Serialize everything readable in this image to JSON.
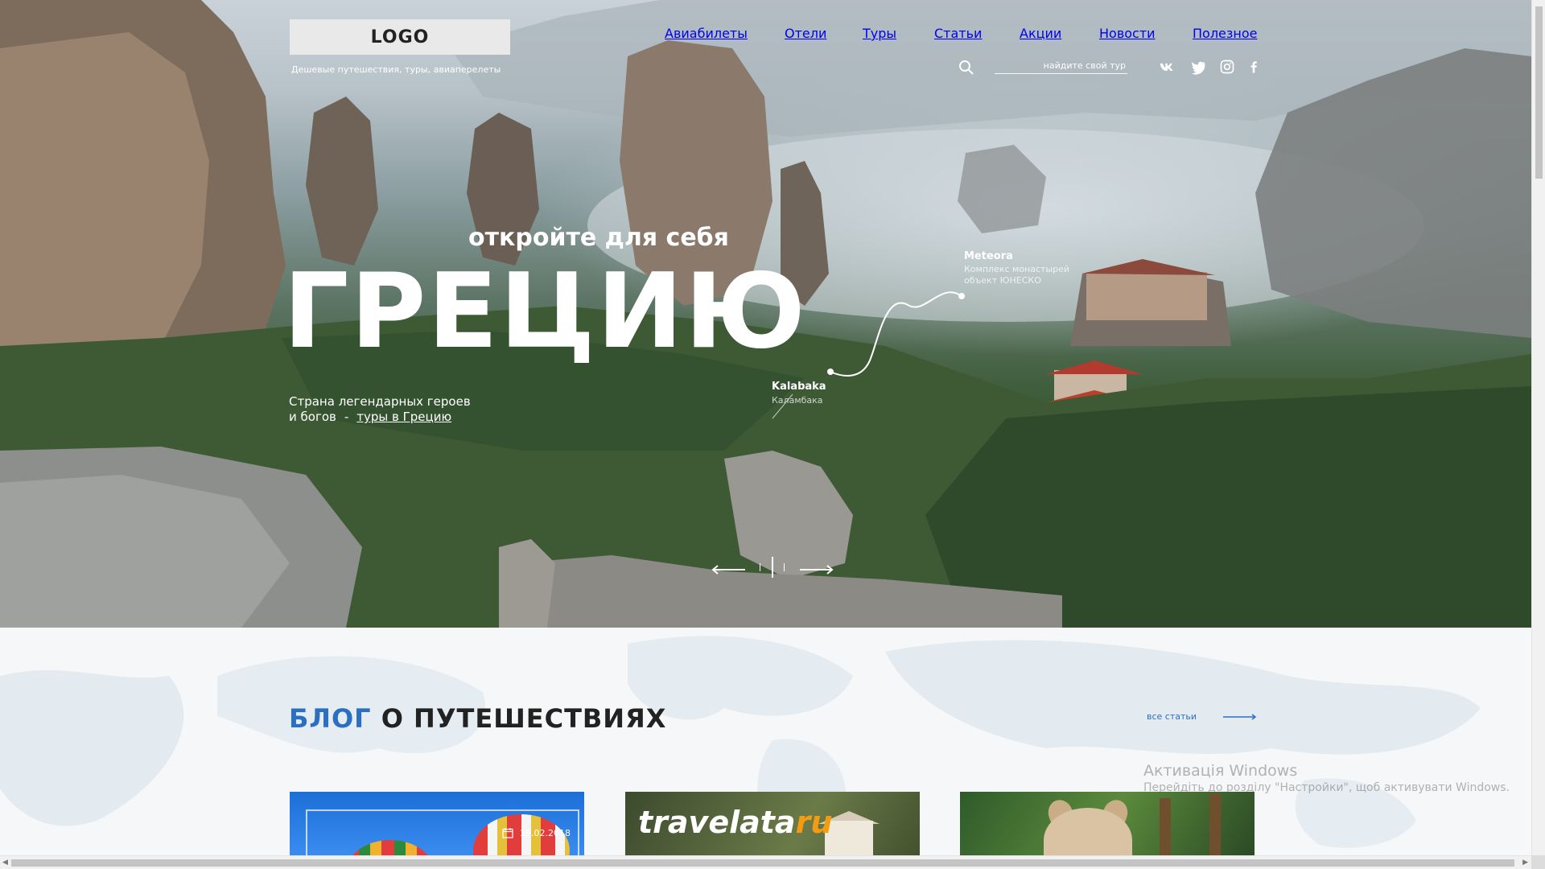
{
  "header": {
    "logo": "LOGO",
    "tagline": "Дешевые путешествия, туры, авиаперелеты",
    "nav": [
      "Авиабилеты",
      "Отели",
      "Туры",
      "Статьи",
      "Акции",
      "Новости",
      "Полезное"
    ],
    "search_placeholder": "найдите свой тур",
    "social": [
      "vk-icon",
      "twitter-icon",
      "instagram-icon",
      "facebook-icon"
    ]
  },
  "hero": {
    "subheadline": "откройте для себя",
    "headline": "ГРЕЦИЮ",
    "description_line1": "Страна легендарных героев",
    "description_line2": "и богов",
    "description_sep": "-",
    "link": "туры в Грецию",
    "pins": [
      {
        "title": "Meteora",
        "sub1": "Комплекс монастырей",
        "sub2": "объект ЮНЕСКО"
      },
      {
        "title": "Kalabaka",
        "sub1": "Каламбака"
      }
    ]
  },
  "blog": {
    "title_accent": "БЛОГ",
    "title_rest": "О ПУТЕШЕСТВИЯХ",
    "all_link": "все статьи",
    "cards": [
      {
        "date": "19.02.2018"
      },
      {
        "brand_main": "travelata",
        "brand_accent": "ru"
      },
      {}
    ]
  },
  "watermark": {
    "title": "Активація Windows",
    "text": "Перейдіть до розділу \"Настройки\", щоб активувати Windows."
  },
  "colors": {
    "accent": "#2b6fc0",
    "brand_orange": "#f39c12"
  }
}
